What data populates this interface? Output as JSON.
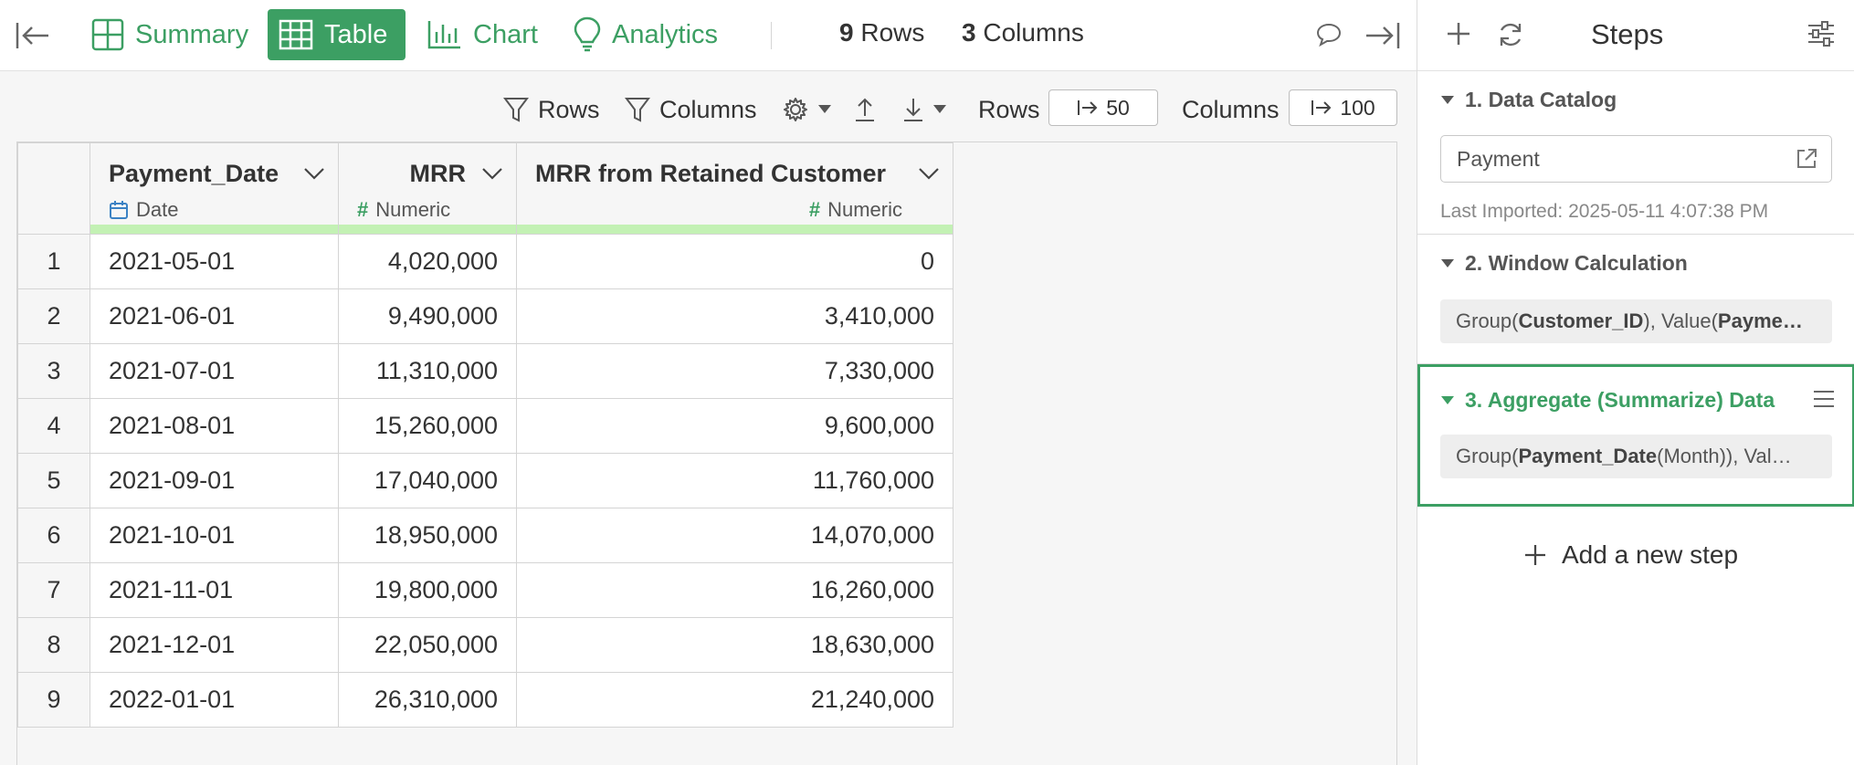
{
  "topbar": {
    "tabs": [
      {
        "label": "Summary",
        "icon": "summary-grid-icon",
        "active": false
      },
      {
        "label": "Table",
        "icon": "table-icon",
        "active": true
      },
      {
        "label": "Chart",
        "icon": "bar-chart-icon",
        "active": false
      },
      {
        "label": "Analytics",
        "icon": "lightbulb-icon",
        "active": false
      }
    ],
    "rows_count": "9",
    "rows_word": "Rows",
    "cols_count": "3",
    "cols_word": "Columns"
  },
  "toolbar": {
    "rows_filter": "Rows",
    "columns_filter": "Columns",
    "rows_label": "Rows",
    "rows_limit": "50",
    "columns_label": "Columns",
    "columns_limit": "100"
  },
  "table": {
    "columns": [
      {
        "name": "Payment_Date",
        "type": "Date"
      },
      {
        "name": "MRR",
        "type": "Numeric"
      },
      {
        "name": "MRR from Retained Customer",
        "type": "Numeric"
      }
    ],
    "rows": [
      [
        "1",
        "2021-05-01",
        "4,020,000",
        "0"
      ],
      [
        "2",
        "2021-06-01",
        "9,490,000",
        "3,410,000"
      ],
      [
        "3",
        "2021-07-01",
        "11,310,000",
        "7,330,000"
      ],
      [
        "4",
        "2021-08-01",
        "15,260,000",
        "9,600,000"
      ],
      [
        "5",
        "2021-09-01",
        "17,040,000",
        "11,760,000"
      ],
      [
        "6",
        "2021-10-01",
        "18,950,000",
        "14,070,000"
      ],
      [
        "7",
        "2021-11-01",
        "19,800,000",
        "16,260,000"
      ],
      [
        "8",
        "2021-12-01",
        "22,050,000",
        "18,630,000"
      ],
      [
        "9",
        "2022-01-01",
        "26,310,000",
        "21,240,000"
      ]
    ]
  },
  "steps_panel": {
    "title": "Steps",
    "steps": [
      {
        "title": "1. Data Catalog",
        "input_value": "Payment",
        "last_imported": "Last Imported: 2025-05-11 4:07:38 PM"
      },
      {
        "title": "2. Window Calculation",
        "summary_prefix": "Group(",
        "summary_bold1": "Customer_ID",
        "summary_mid": "), Value(",
        "summary_bold2": "Payme…"
      },
      {
        "title": "3. Aggregate (Summarize) Data",
        "summary_prefix": "Group(",
        "summary_bold1": "Payment_Date",
        "summary_mid": " (Month)), Val…"
      }
    ],
    "add_step": "Add a new step"
  },
  "colors": {
    "accent": "#3c9f63",
    "header_bar": "#c3f1b4",
    "date_icon": "#3b82c4"
  }
}
